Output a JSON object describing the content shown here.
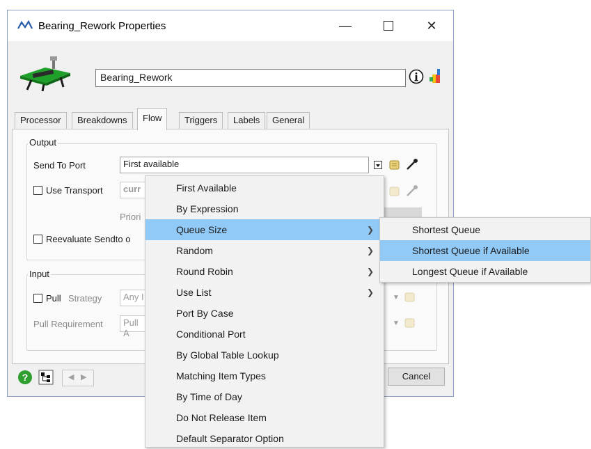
{
  "window": {
    "title": "Bearing_Rework  Properties",
    "object_name": "Bearing_Rework"
  },
  "tabs": [
    "Processor",
    "Breakdowns",
    "Flow",
    "Triggers",
    "Labels",
    "General"
  ],
  "active_tab": "Flow",
  "output": {
    "group_label": "Output",
    "send_to_port_label": "Send To Port",
    "send_to_port_value": "First available",
    "use_transport_label": "Use Transport",
    "transport_value": "curr",
    "priority_label": "Priori",
    "reevaluate_label": "Reevaluate Sendto o"
  },
  "input": {
    "group_label": "Input",
    "pull_label": "Pull",
    "strategy_label": "Strategy",
    "strategy_value": "Any I",
    "pull_requirement_label": "Pull Requirement",
    "pull_requirement_value": "Pull A"
  },
  "footer": {
    "cancel_label": "Cancel"
  },
  "menu": {
    "items": [
      {
        "label": "First Available",
        "submenu": false
      },
      {
        "label": "By Expression",
        "submenu": false
      },
      {
        "label": "Queue Size",
        "submenu": true
      },
      {
        "label": "Random",
        "submenu": true
      },
      {
        "label": "Round Robin",
        "submenu": true
      },
      {
        "label": "Use List",
        "submenu": true
      },
      {
        "label": "Port By Case",
        "submenu": false
      },
      {
        "label": "Conditional Port",
        "submenu": false
      },
      {
        "label": "By Global Table Lookup",
        "submenu": false
      },
      {
        "label": "Matching Item Types",
        "submenu": false
      },
      {
        "label": "By Time of Day",
        "submenu": false
      },
      {
        "label": "Do Not Release Item",
        "submenu": false
      },
      {
        "label": "Default Separator Option",
        "submenu": false
      }
    ],
    "highlighted": "Queue Size"
  },
  "submenu": {
    "items": [
      "Shortest Queue",
      "Shortest Queue if Available",
      "Longest Queue if Available"
    ],
    "highlighted": "Shortest Queue if Available"
  },
  "colors": {
    "highlight": "#91c9f7",
    "window_bg": "#f0f0f0",
    "help_green": "#2e9e2e"
  }
}
